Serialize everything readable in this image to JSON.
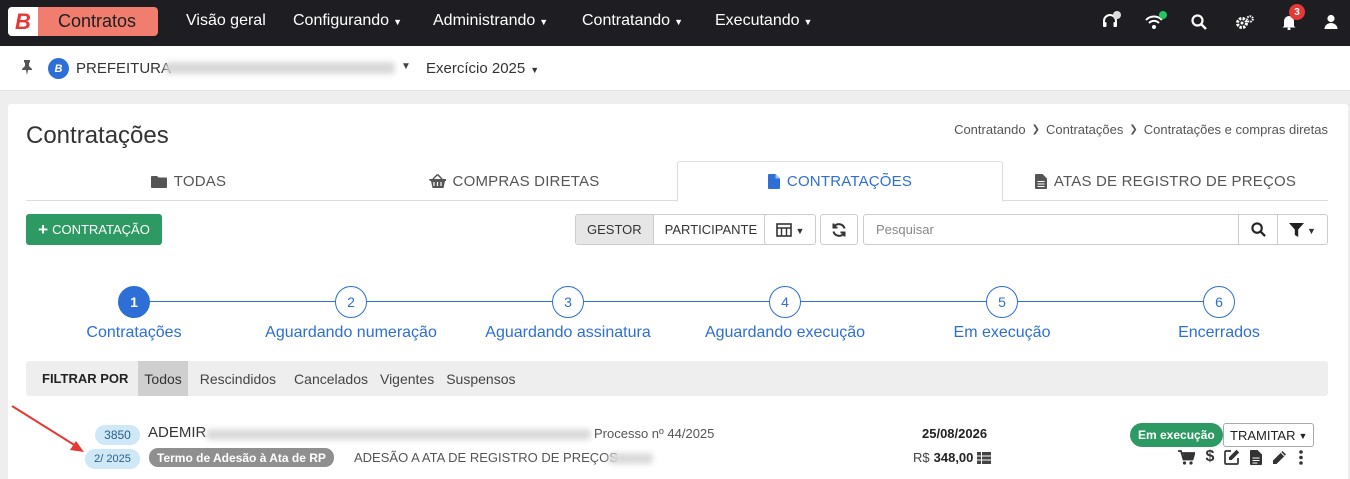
{
  "brand": {
    "letter": "B",
    "name": "Contratos"
  },
  "nav": [
    {
      "label": "Visão geral",
      "caret": false
    },
    {
      "label": "Configurando",
      "caret": true
    },
    {
      "label": "Administrando",
      "caret": true
    },
    {
      "label": "Contratando",
      "caret": true
    },
    {
      "label": "Executando",
      "caret": true
    }
  ],
  "navbar_icons": [
    "headset-icon",
    "wifi-icon",
    "search-icon",
    "settings-icon",
    "bell-icon",
    "user-icon"
  ],
  "notifications_count": "3",
  "org": {
    "badge": "B",
    "name": "PREFEITURA",
    "exercicio": "Exercício 2025"
  },
  "page": {
    "title": "Contratações",
    "breadcrumb": [
      "Contratando",
      "Contratações",
      "Contratações e compras diretas"
    ]
  },
  "tabs": [
    {
      "label": "TODAS",
      "icon": "folder-icon"
    },
    {
      "label": "COMPRAS DIRETAS",
      "icon": "basket-icon"
    },
    {
      "label": "CONTRATAÇÕES",
      "icon": "file-icon"
    },
    {
      "label": "ATAS DE REGISTRO DE PREÇOS",
      "icon": "file-text-icon"
    }
  ],
  "toolbar": {
    "new_label": "CONTRATAÇÃO",
    "gestor": "GESTOR",
    "participante": "PARTICIPANTE",
    "search_placeholder": "Pesquisar"
  },
  "steps": [
    {
      "num": "1",
      "label": "Contratações"
    },
    {
      "num": "2",
      "label": "Aguardando numeração"
    },
    {
      "num": "3",
      "label": "Aguardando assinatura"
    },
    {
      "num": "4",
      "label": "Aguardando execução"
    },
    {
      "num": "5",
      "label": "Em execução"
    },
    {
      "num": "6",
      "label": "Encerrados"
    }
  ],
  "filter": {
    "label": "FILTRAR POR",
    "options": [
      "Todos",
      "Rescindidos",
      "Cancelados",
      "Vigentes",
      "Suspensos"
    ]
  },
  "row": {
    "id": "3850",
    "number": "2/ 2025",
    "name": "ADEMIR",
    "processo": "Processo nº 44/2025",
    "tag": "Termo de Adesão à Ata de RP",
    "description": "ADESÃO A ATA DE REGISTRO DE PREÇOS -",
    "date": "25/08/2026",
    "currency": "R$",
    "value": "348,00",
    "status": "Em execução",
    "tramitar": "TRAMITAR"
  },
  "colors": {
    "navbar": "#1e1e22",
    "brand": "#f07d6d",
    "primary": "#2d6fd6",
    "success": "#2e9a63",
    "danger": "#e53935"
  }
}
